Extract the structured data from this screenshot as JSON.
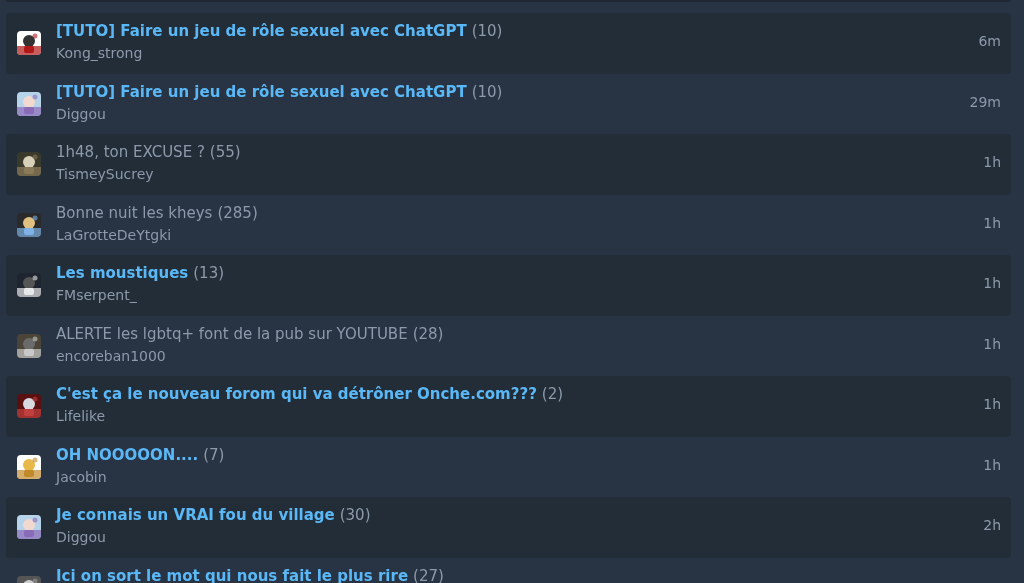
{
  "topics": [
    {
      "title": "[TUTO] Faire un jeu de rôle sexuel avec ChatGPT",
      "count": "(10)",
      "author": "Kong_strong",
      "time": "6m",
      "unread": true
    },
    {
      "title": "[TUTO] Faire un jeu de rôle sexuel avec ChatGPT",
      "count": "(10)",
      "author": "Diggou",
      "time": "29m",
      "unread": true
    },
    {
      "title": "1h48, ton EXCUSE ?",
      "count": "(55)",
      "author": "TismeySucrey",
      "time": "1h",
      "unread": false
    },
    {
      "title": "Bonne nuit les kheys",
      "count": "(285)",
      "author": "LaGrotteDeYtgki",
      "time": "1h",
      "unread": false
    },
    {
      "title": "Les moustiques",
      "count": "(13)",
      "author": "FMserpent_",
      "time": "1h",
      "unread": true
    },
    {
      "title": "ALERTE les lgbtq+ font de la pub sur YOUTUBE",
      "count": "(28)",
      "author": "encoreban1000",
      "time": "1h",
      "unread": false
    },
    {
      "title": "C'est ça le nouveau forom qui va détrôner Onche.com???",
      "count": "(2)",
      "author": "Lifelike",
      "time": "1h",
      "unread": true
    },
    {
      "title": "OH NOOOOON....",
      "count": "(7)",
      "author": "Jacobin",
      "time": "1h",
      "unread": true
    },
    {
      "title": "Je connais un VRAI fou du village",
      "count": "(30)",
      "author": "Diggou",
      "time": "2h",
      "unread": true
    },
    {
      "title": "Ici on sort le mot qui nous fait le plus rire",
      "count": "(27)",
      "unread": true
    }
  ]
}
